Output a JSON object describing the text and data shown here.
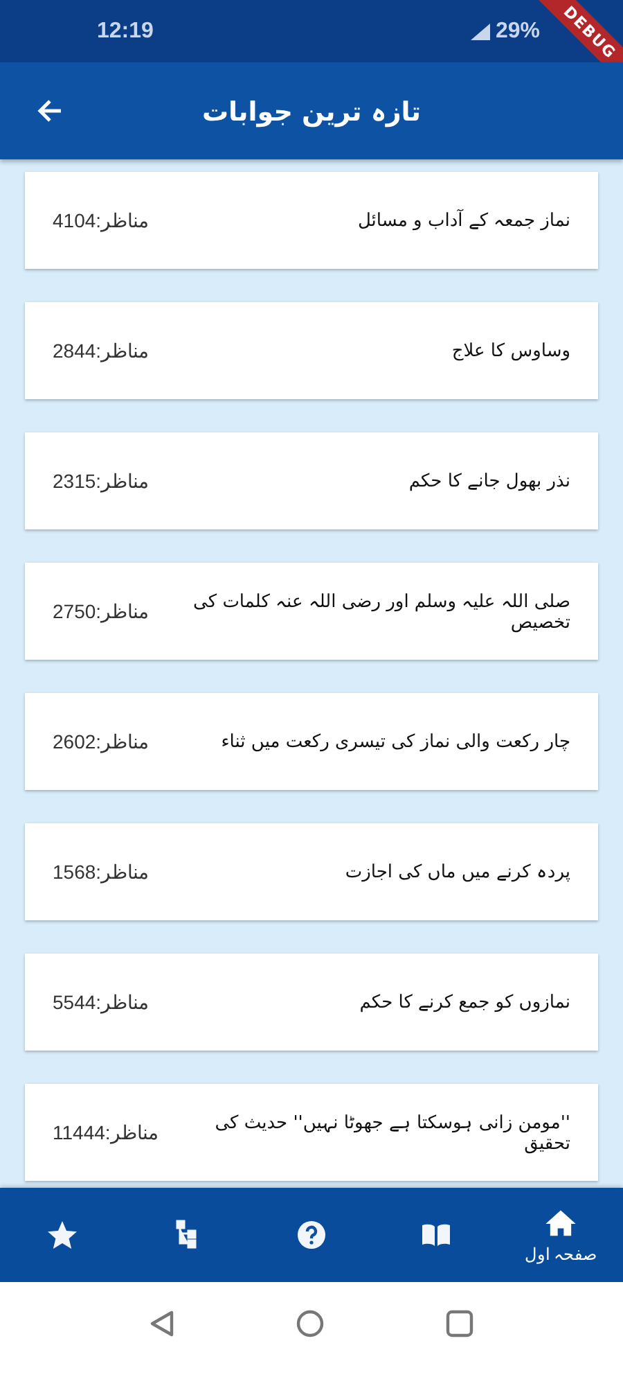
{
  "status_bar": {
    "time": "12:19",
    "battery": "29%"
  },
  "debug_banner": "DEBUG",
  "app_bar": {
    "title": "تازہ ترین جوابات"
  },
  "answers": [
    {
      "title": "نماز جمعہ کے آداب و مسائل",
      "views": "مناظر:4104"
    },
    {
      "title": "وساوس کا علاج",
      "views": "مناظر:2844"
    },
    {
      "title": "نذر بھول جانے کا حکم",
      "views": "مناظر:2315"
    },
    {
      "title": "صلی اللہ علیہ وسلم اور رضی اللہ عنہ کلمات کی تخصیص",
      "views": "مناظر:2750"
    },
    {
      "title": "چار رکعت والی نماز کی تیسری رکعت میں ثناء",
      "views": "مناظر:2602"
    },
    {
      "title": "پردہ کرنے میں ماں کی اجازت",
      "views": "مناظر:1568"
    },
    {
      "title": "نمازوں کو جمع کرنے کا حکم",
      "views": "مناظر:5544"
    },
    {
      "title": "''مومن زانی ہوسکتا ہے جھوٹا نہیں'' حدیث کی تحقیق",
      "views": "مناظر:11444"
    }
  ],
  "bottom_nav": [
    {
      "kind": "home",
      "label": "صفحہ اول",
      "selected": true
    },
    {
      "kind": "book",
      "selected": false
    },
    {
      "kind": "help",
      "selected": false
    },
    {
      "kind": "tree",
      "selected": false
    },
    {
      "kind": "star",
      "selected": false
    }
  ]
}
